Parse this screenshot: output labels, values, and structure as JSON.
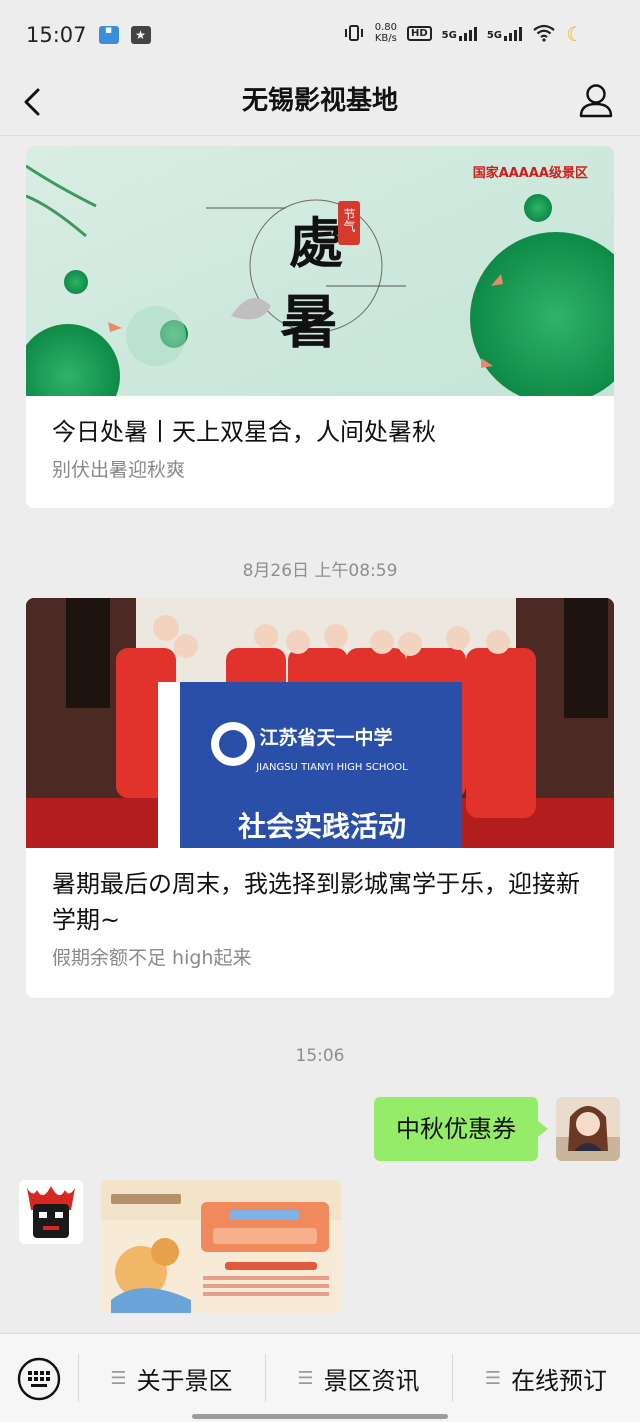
{
  "status_bar": {
    "time": "15:07",
    "speed_top": "0.80",
    "speed_bottom": "KB/s",
    "hd_badge": "HD",
    "net1": "5G",
    "net2": "5G"
  },
  "nav": {
    "title": "无锡影视基地"
  },
  "articles": [
    {
      "title": "今日处暑丨天上双星合，人间处暑秋",
      "subtitle": "别伏出暑迎秋爽",
      "banner_tag": "国家AAAAA级景区",
      "banner_calligraphy_1": "處",
      "banner_calligraphy_2": "暑",
      "banner_seal": "节气"
    },
    {
      "title": "暑期最后の周末，我选择到影城寓学于乐，迎接新学期~",
      "subtitle": "假期余额不足 high起来",
      "banner_school_cn": "江苏省天一中学",
      "banner_school_en": "JIANGSU TIANYI HIGH SCHOOL",
      "banner_activity": "社会实践活动"
    }
  ],
  "timestamps": {
    "t1": "8月26日 上午08:59",
    "t2": "15:06"
  },
  "chat": {
    "my_message": "中秋优惠券"
  },
  "bottom_menu": {
    "items": [
      "关于景区",
      "景区资讯",
      "在线预订"
    ]
  },
  "colors": {
    "bubble_green": "#95ec69",
    "background": "#ededed"
  }
}
